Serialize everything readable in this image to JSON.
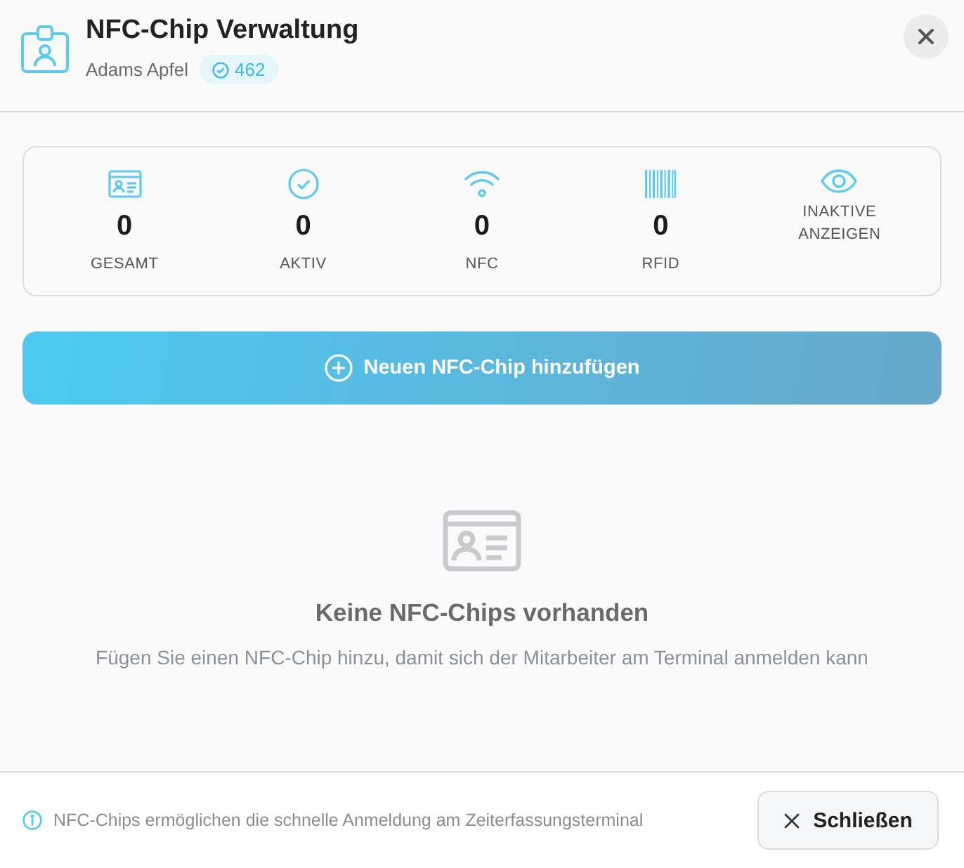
{
  "header": {
    "title": "NFC-Chip Verwaltung",
    "subtitle": "Adams Apfel",
    "badge": "462"
  },
  "stats": [
    {
      "kind": "count",
      "value": "0",
      "label": "GESAMT"
    },
    {
      "kind": "count",
      "value": "0",
      "label": "AKTIV"
    },
    {
      "kind": "count",
      "value": "0",
      "label": "NFC"
    },
    {
      "kind": "count",
      "value": "0",
      "label": "RFID"
    },
    {
      "kind": "toggle",
      "label": "INAKTIVE ANZEIGEN"
    }
  ],
  "add_button": {
    "label": "Neuen NFC-Chip hinzufügen"
  },
  "empty_state": {
    "title": "Keine NFC-Chips vorhanden",
    "message": "Fügen Sie einen NFC-Chip hinzu, damit sich der Mitarbeiter am Terminal anmelden kann"
  },
  "footer": {
    "info": "NFC-Chips ermöglichen die schnelle Anmeldung am Zeiterfassungsterminal",
    "close_button": "Schließen"
  }
}
